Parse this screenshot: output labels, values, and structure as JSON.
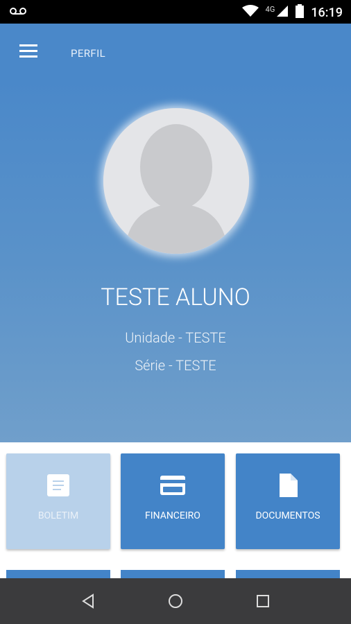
{
  "status": {
    "time": "16:19",
    "network": "4G"
  },
  "header": {
    "title": "PERFIL"
  },
  "profile": {
    "name": "TESTE ALUNO",
    "unit": "Unidade - TESTE",
    "series": "Série - TESTE"
  },
  "tiles": [
    {
      "label": "BOLETIM",
      "icon": "document-lines-icon",
      "enabled": false
    },
    {
      "label": "FINANCEIRO",
      "icon": "credit-card-icon",
      "enabled": true
    },
    {
      "label": "DOCUMENTOS",
      "icon": "file-icon",
      "enabled": true
    }
  ],
  "colors": {
    "primary": "#4a88c9",
    "tile": "#4384c8",
    "tile_disabled": "#b8d1ea",
    "nav": "#3b3b3d"
  }
}
